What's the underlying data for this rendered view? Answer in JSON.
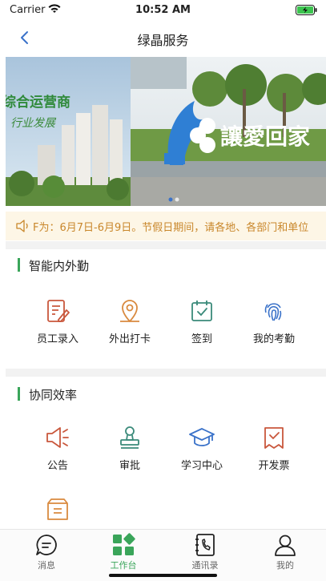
{
  "status_bar": {
    "carrier": "Carrier",
    "time": "10:52 AM",
    "wifi_icon": "wifi-icon",
    "battery_icon": "battery-charging-icon"
  },
  "nav": {
    "title": "绿晶服务",
    "back_icon": "chevron-left-icon"
  },
  "banner": {
    "left_slide_text_1": "综合运营商",
    "left_slide_text_2": "行业发展",
    "right_slide_text": "讓愛回家",
    "page_count": 2,
    "active_page": 1
  },
  "notice": {
    "icon": "speaker-icon",
    "text": "F为：6月7日-6月9日。节假日期间，请各地、各部门和单位"
  },
  "sections": [
    {
      "title": "智能内外勤",
      "items": [
        {
          "label": "员工录入",
          "icon": "form-edit-icon"
        },
        {
          "label": "外出打卡",
          "icon": "location-pin-icon"
        },
        {
          "label": "签到",
          "icon": "calendar-check-icon"
        },
        {
          "label": "我的考勤",
          "icon": "fingerprint-icon"
        }
      ]
    },
    {
      "title": "协同效率",
      "items": [
        {
          "label": "公告",
          "icon": "megaphone-icon"
        },
        {
          "label": "审批",
          "icon": "stamp-icon"
        },
        {
          "label": "学习中心",
          "icon": "graduation-cap-icon"
        },
        {
          "label": "开发票",
          "icon": "invoice-icon"
        },
        {
          "label": "",
          "icon": "archive-box-icon"
        }
      ]
    }
  ],
  "tab_bar": {
    "items": [
      {
        "label": "消息",
        "icon": "chat-bubble-icon",
        "active": false
      },
      {
        "label": "工作台",
        "icon": "workbench-grid-icon",
        "active": true
      },
      {
        "label": "通讯录",
        "icon": "phone-book-icon",
        "active": false
      },
      {
        "label": "我的",
        "icon": "user-icon",
        "active": false
      }
    ]
  },
  "colors": {
    "accent_green": "#3aa55a",
    "icon_orange": "#d98a3f",
    "icon_red": "#c9573c",
    "icon_teal": "#3a8a7a",
    "icon_blue": "#3a72c9",
    "notice_text": "#c9872b",
    "notice_bg": "#fdf6e6"
  }
}
